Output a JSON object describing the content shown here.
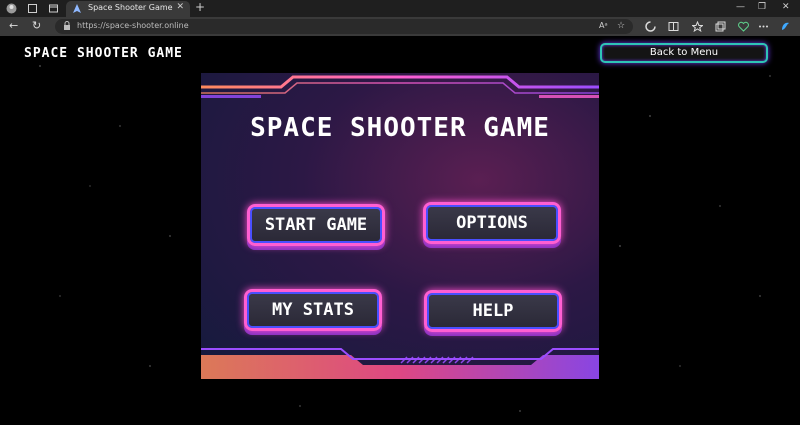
{
  "browser": {
    "tab_title": "Space Shooter Game",
    "url": "https://space-shooter.online",
    "new_tab_symbol": "+",
    "tab_close_symbol": "✕",
    "window_controls": [
      "—",
      "❐",
      "✕"
    ]
  },
  "page": {
    "header_title": "SPACE SHOOTER GAME",
    "back_button_label": "Back to Menu"
  },
  "game": {
    "title": "SPACE SHOOTER GAME",
    "menu": {
      "start_label": "START GAME",
      "options_label": "OPTIONS",
      "stats_label": "MY STATS",
      "help_label": "HELP"
    }
  },
  "colors": {
    "neon_pink": "#ff5fd2",
    "neon_purple": "#9b4dff",
    "neon_orange": "#ff8a5c",
    "teal_border": "#2ec4b6"
  }
}
